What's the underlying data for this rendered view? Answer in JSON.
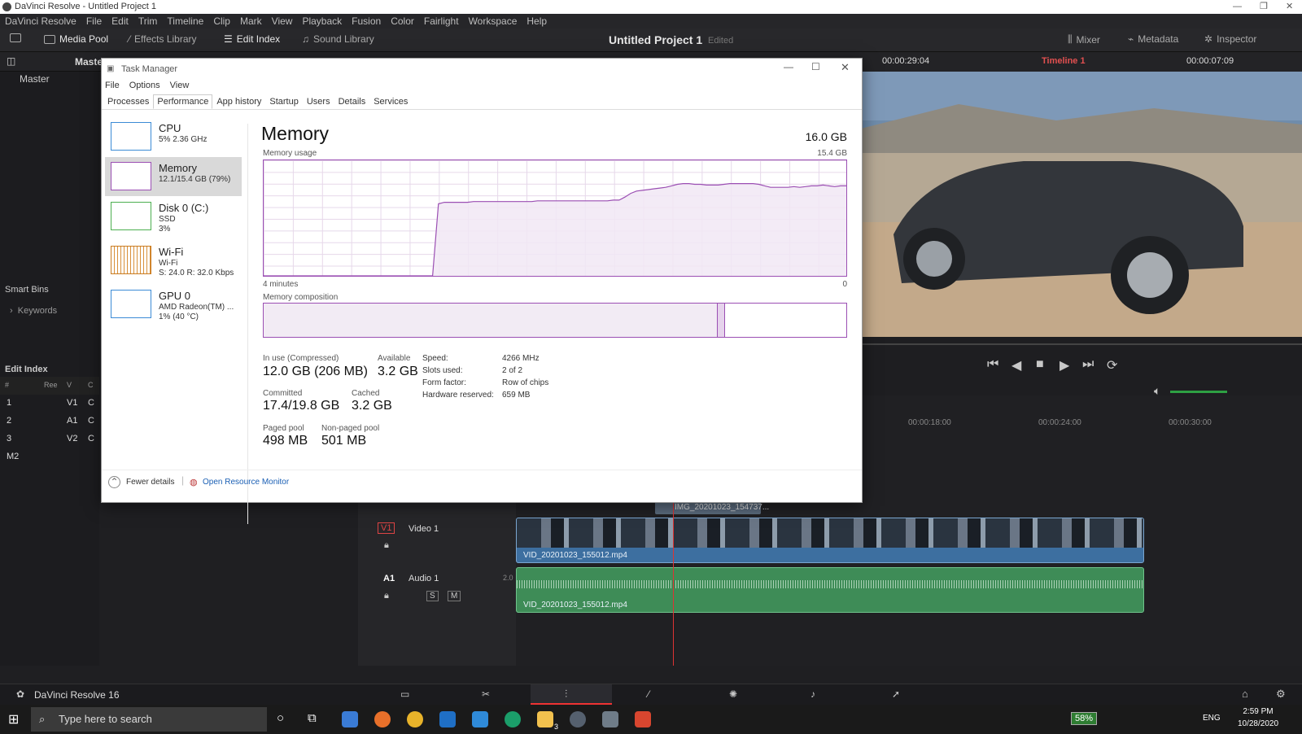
{
  "window": {
    "title": "DaVinci Resolve - Untitled Project 1"
  },
  "menu": [
    "DaVinci Resolve",
    "File",
    "Edit",
    "Trim",
    "Timeline",
    "Clip",
    "Mark",
    "View",
    "Playback",
    "Fusion",
    "Color",
    "Fairlight",
    "Workspace",
    "Help"
  ],
  "toolbar": {
    "media_pool": "Media Pool",
    "effects_library": "Effects Library",
    "edit_index": "Edit Index",
    "sound_library": "Sound Library",
    "project_title": "Untitled Project 1",
    "project_status": "Edited",
    "mixer": "Mixer",
    "metadata": "Metadata",
    "inspector": "Inspector"
  },
  "subbar": {
    "master": "Maste",
    "timecode_left": "00:00:29:04",
    "timeline_name": "Timeline 1",
    "timecode_right": "00:00:07:09"
  },
  "left_panel": {
    "master": "Master",
    "smart_bins": "Smart Bins",
    "keywords": "Keywords",
    "edit_index": "Edit Index",
    "index_cols": [
      "#",
      "Ree",
      "V",
      "C"
    ],
    "index_rows": [
      {
        "n": "1",
        "track": "V1",
        "c": "C"
      },
      {
        "n": "2",
        "track": "A1",
        "c": "C"
      },
      {
        "n": "3",
        "track": "V2",
        "c": "C"
      }
    ],
    "marker": "M2"
  },
  "timeline": {
    "ruler": [
      "00:00:18:00",
      "00:00:24:00",
      "00:00:30:00"
    ],
    "compound_clip": "IMG_20201023_154737...",
    "video_track": {
      "id": "V1",
      "name": "Video 1",
      "clip": "VID_20201023_155012.mp4"
    },
    "audio_track": {
      "id": "A1",
      "name": "Audio 1",
      "level": "2.0",
      "clip": "VID_20201023_155012.mp4"
    }
  },
  "footer": {
    "app": "DaVinci Resolve 16"
  },
  "taskbar": {
    "search_placeholder": "Type here to search",
    "battery": "58%",
    "lang": "ENG",
    "time": "2:59 PM",
    "date": "10/28/2020",
    "badge": "3"
  },
  "task_manager": {
    "title": "Task Manager",
    "menu": [
      "File",
      "Options",
      "View"
    ],
    "tabs": [
      "Processes",
      "Performance",
      "App history",
      "Startup",
      "Users",
      "Details",
      "Services"
    ],
    "resources": [
      {
        "name": "CPU",
        "line1": "5% 2.36 GHz",
        "line2": ""
      },
      {
        "name": "Memory",
        "line1": "12.1/15.4 GB (79%)",
        "line2": ""
      },
      {
        "name": "Disk 0 (C:)",
        "line1": "SSD",
        "line2": "3%"
      },
      {
        "name": "Wi-Fi",
        "line1": "Wi-Fi",
        "line2": "S: 24.0 R: 32.0 Kbps"
      },
      {
        "name": "GPU 0",
        "line1": "AMD Radeon(TM) ...",
        "line2": "1% (40 °C)"
      }
    ],
    "heading": "Memory",
    "total": "16.0 GB",
    "usage_label": "Memory usage",
    "usage_max": "15.4 GB",
    "time_label": "4 minutes",
    "time_zero": "0",
    "composition_label": "Memory composition",
    "stats": {
      "in_use_label": "In use (Compressed)",
      "in_use": "12.0 GB (206 MB)",
      "available_label": "Available",
      "available": "3.2 GB",
      "committed_label": "Committed",
      "committed": "17.4/19.8 GB",
      "cached_label": "Cached",
      "cached": "3.2 GB",
      "paged_label": "Paged pool",
      "paged": "498 MB",
      "nonpaged_label": "Non-paged pool",
      "nonpaged": "501 MB"
    },
    "details": [
      {
        "k": "Speed:",
        "v": "4266 MHz"
      },
      {
        "k": "Slots used:",
        "v": "2 of 2"
      },
      {
        "k": "Form factor:",
        "v": "Row of chips"
      },
      {
        "k": "Hardware reserved:",
        "v": "659 MB"
      }
    ],
    "fewer_details": "Fewer details",
    "open_monitor": "Open Resource Monitor"
  },
  "chart_data": {
    "type": "area",
    "title": "Memory usage",
    "series": [
      {
        "values": [
          0,
          0,
          0,
          0,
          0,
          0,
          0,
          0,
          0,
          0,
          0,
          0,
          0,
          0,
          0,
          0,
          0,
          0,
          0,
          0,
          0,
          0,
          0,
          0,
          0,
          0,
          0,
          0,
          0,
          0,
          9.6,
          9.8,
          9.8,
          9.8,
          9.8,
          9.8,
          9.9,
          9.9,
          9.9,
          9.9,
          9.9,
          9.9,
          9.9,
          9.9,
          9.9,
          9.9,
          9.9,
          10.0,
          10.0,
          10.0,
          10.0,
          10.0,
          10.0,
          10.0,
          10.0,
          10.0,
          10.0,
          10.0,
          10.0,
          10.0,
          10.1,
          10.1,
          10.5,
          11.0,
          11.3,
          11.4,
          11.5,
          11.6,
          11.7,
          11.8,
          12.0,
          12.2,
          12.3,
          12.3,
          12.2,
          12.2,
          12.1,
          12.1,
          12.1,
          12.2,
          12.3,
          12.3,
          12.3,
          12.3,
          12.3,
          12.2,
          12.0,
          11.8,
          11.8,
          11.8,
          11.8,
          11.9,
          11.8,
          11.9,
          12.0,
          12.0,
          12.1,
          12.0,
          11.9,
          12.0,
          12.0
        ]
      }
    ],
    "ylim": [
      0,
      15.4
    ],
    "xlabel": "4 minutes",
    "composition": {
      "in_use": 12.0,
      "modified": 0.2,
      "total": 15.4
    }
  }
}
